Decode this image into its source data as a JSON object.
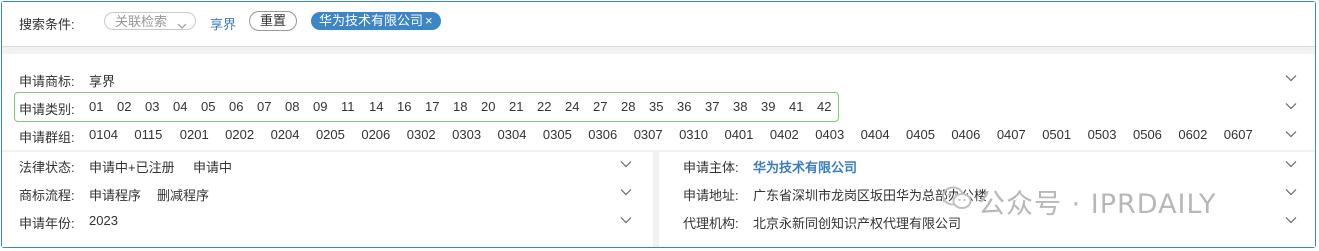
{
  "search": {
    "label": "搜索条件:",
    "filter_placeholder": "关联检索",
    "term_link": "享界",
    "reset_label": "重置",
    "chip_label": "华为技术有限公司",
    "chip_close": "×"
  },
  "rows": {
    "trademark": {
      "label": "申请商标:",
      "value": "享界"
    },
    "category": {
      "label": "申请类别:",
      "codes": [
        "01",
        "02",
        "03",
        "04",
        "05",
        "06",
        "07",
        "08",
        "09",
        "11",
        "14",
        "16",
        "17",
        "18",
        "20",
        "21",
        "22",
        "24",
        "27",
        "28",
        "35",
        "36",
        "37",
        "38",
        "39",
        "41",
        "42"
      ]
    },
    "group": {
      "label": "申请群组:",
      "codes": [
        "0104",
        "0115",
        "0201",
        "0202",
        "0204",
        "0205",
        "0206",
        "0302",
        "0303",
        "0304",
        "0305",
        "0306",
        "0307",
        "0310",
        "0401",
        "0402",
        "0403",
        "0404",
        "0405",
        "0406",
        "0407",
        "0501",
        "0503",
        "0506",
        "0602",
        "0607"
      ]
    }
  },
  "left_fields": [
    {
      "label": "法律状态:",
      "values": [
        "申请中+已注册",
        "申请中"
      ]
    },
    {
      "label": "商标流程:",
      "values": [
        "申请程序",
        "删减程序"
      ]
    },
    {
      "label": "申请年份:",
      "values": [
        "2023"
      ]
    }
  ],
  "right_fields": [
    {
      "label": "申请主体:",
      "value": "华为技术有限公司",
      "highlight": true
    },
    {
      "label": "申请地址:",
      "value": "广东省深圳市龙岗区坂田华为总部办公楼"
    },
    {
      "label": "代理机构:",
      "value": "北京永新同创知识产权代理有限公司"
    }
  ],
  "watermark": {
    "text": "公众号 · IPRDAILY",
    "icon": "wechat-icon"
  },
  "colors": {
    "accent": "#3a86c8",
    "highlight_box": "#7fc97a",
    "border": "#3a84c9"
  }
}
